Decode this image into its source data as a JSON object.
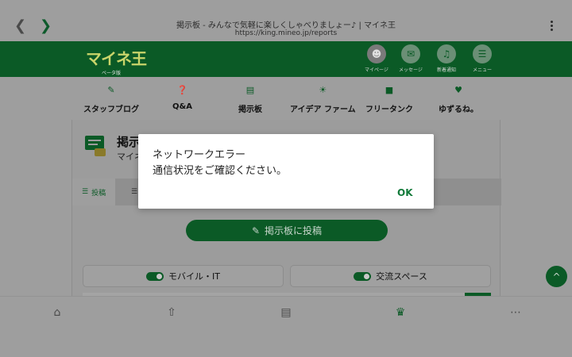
{
  "browser": {
    "page_title": "掲示板 - みんなで気軽に楽しくしゃべりましょー♪ | マイネ王",
    "url": "https://king.mineo.jp/reports"
  },
  "header": {
    "logo": "マイネ王",
    "logo_sub": "ベータ版",
    "icons": [
      {
        "label": "マイページ",
        "icon": "avatar"
      },
      {
        "label": "メッセージ",
        "icon": "mail-icon"
      },
      {
        "label": "新着通知",
        "icon": "bell-icon"
      },
      {
        "label": "メニュー",
        "icon": "hamburger-icon"
      }
    ]
  },
  "categories": [
    {
      "label": "スタッフブログ",
      "icon": "pen-icon"
    },
    {
      "label": "Q&A",
      "icon": "qa-icon"
    },
    {
      "label": "掲示板",
      "icon": "board-icon"
    },
    {
      "label": "アイデア ファーム",
      "icon": "bulb-icon"
    },
    {
      "label": "フリータンク",
      "icon": "tank-icon"
    },
    {
      "label": "ゆずるね。",
      "icon": "heart-icon"
    }
  ],
  "board": {
    "title": "掲示",
    "subtitle": "マイネ",
    "tab_active": "投稿",
    "post_button": "掲示板に投稿",
    "filters": [
      "モバイル・IT",
      "交流スペース"
    ]
  },
  "dialog": {
    "line1": "ネットワークエラー",
    "line2": "通信状況をご確認ください。",
    "ok": "OK"
  },
  "colors": {
    "brand_green": "#0b5a26",
    "dialog_ok": "#127a3a",
    "overlay_gray": "#9e9e9e"
  }
}
